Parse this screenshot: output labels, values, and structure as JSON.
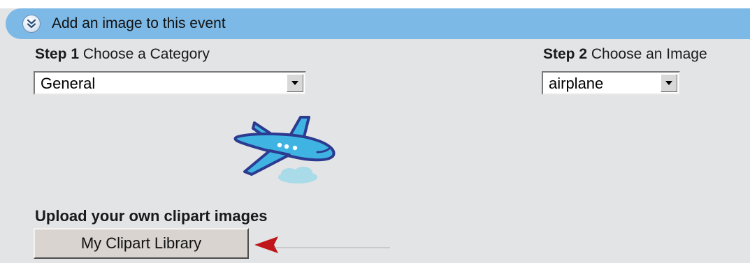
{
  "header": {
    "title": "Add an image to this event",
    "collapse_icon": "double-chevron-down-icon"
  },
  "step1": {
    "step_number": "Step 1",
    "text": "Choose a Category",
    "selected": "General"
  },
  "step2": {
    "step_number": "Step 2",
    "text": "Choose an Image",
    "selected": "airplane"
  },
  "preview": {
    "icon": "airplane-clipart-icon"
  },
  "upload": {
    "heading": "Upload your own clipart images",
    "button_label": "My Clipart Library"
  },
  "annotation": {
    "icon": "red-arrow-icon",
    "color": "#c0161b"
  },
  "colors": {
    "header_bar": "#7db9e6",
    "panel_background": "#e3e4e6",
    "button_face": "#d9d4cf"
  }
}
